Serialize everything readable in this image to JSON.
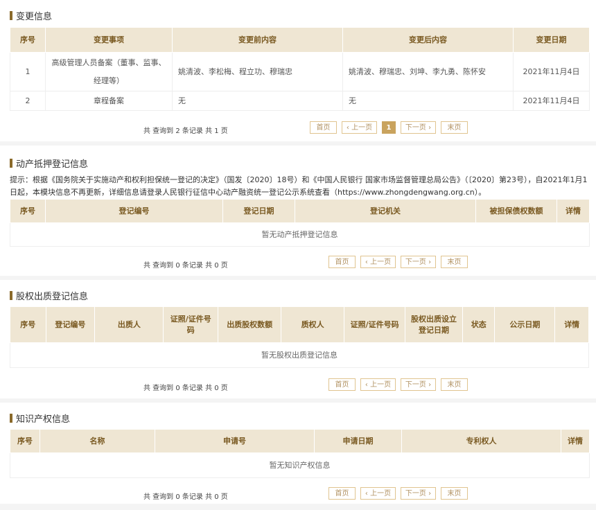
{
  "change": {
    "title": "变更信息",
    "headers": [
      "序号",
      "变更事项",
      "变更前内容",
      "变更后内容",
      "变更日期"
    ],
    "rows": [
      [
        "1",
        "高级管理人员备案（董事、监事、经理等）",
        "姚清波、李松梅、程立功、穆瑞忠",
        "姚清波、穆瑞忠、刘坤、李九勇、陈怀安",
        "2021年11月4日"
      ],
      [
        "2",
        "章程备案",
        "无",
        "无",
        "2021年11月4日"
      ]
    ],
    "pager": {
      "count": "共 查询到 2 条记录 共 1 页",
      "first": "首页",
      "prev": "‹ 上一页",
      "current": "1",
      "next": "下一页 ›",
      "last": "末页"
    }
  },
  "mortgage": {
    "title": "动产抵押登记信息",
    "notice": "提示：根据《国务院关于实施动产和权利担保统一登记的决定》（国发〔2020〕18号）和《中国人民银行 国家市场监督管理总局公告》（〔2020〕第23号），自2021年1月1日起，本模块信息不再更新，详细信息请登录人民银行征信中心动产融资统一登记公示系统查看（https://www.zhongdengwang.org.cn）。",
    "headers": [
      "序号",
      "登记编号",
      "登记日期",
      "登记机关",
      "被担保债权数额",
      "详情"
    ],
    "empty": "暂无动产抵押登记信息",
    "pager": {
      "count": "共 查询到 0 条记录 共 0 页",
      "first": "首页",
      "prev": "‹ 上一页",
      "next": "下一页 ›",
      "last": "末页"
    }
  },
  "pledge": {
    "title": "股权出质登记信息",
    "headers": [
      "序号",
      "登记编号",
      "出质人",
      "证照/证件号码",
      "出质股权数额",
      "质权人",
      "证照/证件号码",
      "股权出质设立登记日期",
      "状态",
      "公示日期",
      "详情"
    ],
    "empty": "暂无股权出质登记信息",
    "pager": {
      "count": "共 查询到 0 条记录 共 0 页",
      "first": "首页",
      "prev": "‹ 上一页",
      "next": "下一页 ›",
      "last": "末页"
    }
  },
  "ip": {
    "title": "知识产权信息",
    "headers": [
      "序号",
      "名称",
      "申请号",
      "申请日期",
      "专利权人",
      "详情"
    ],
    "empty": "暂无知识产权信息",
    "pager": {
      "count": "共 查询到 0 条记录 共 0 页",
      "first": "首页",
      "prev": "‹ 上一页",
      "next": "下一页 ›",
      "last": "末页"
    }
  }
}
